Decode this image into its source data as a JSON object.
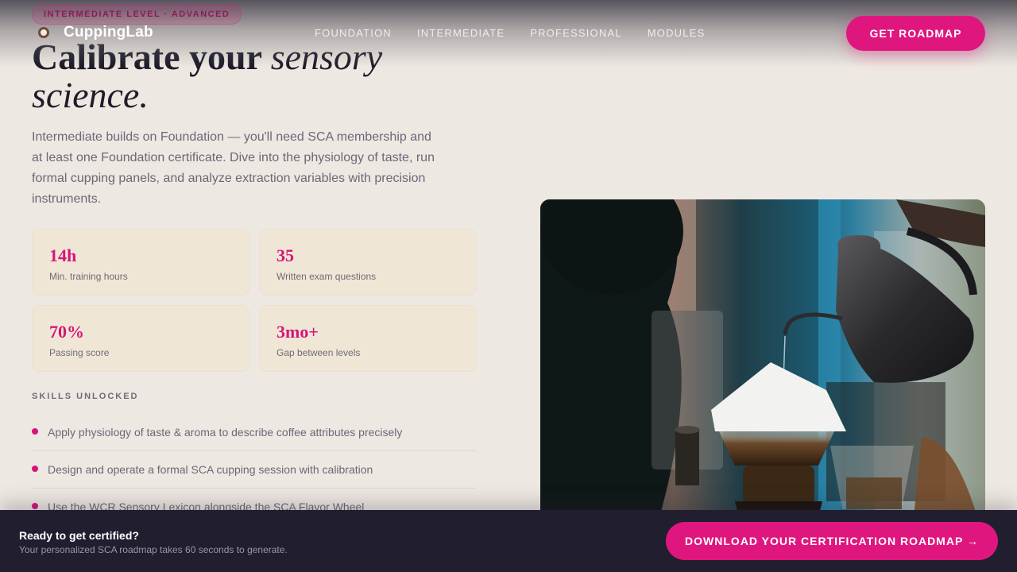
{
  "header": {
    "level_badge": "INTERMEDIATE LEVEL · ADVANCED",
    "brand": "CuppingLab",
    "nav": [
      "FOUNDATION",
      "INTERMEDIATE",
      "PROFESSIONAL",
      "MODULES"
    ],
    "cta": "GET ROADMAP"
  },
  "hero": {
    "headline_strong": "Calibrate your",
    "headline_italic_1": "sensory",
    "headline_italic_2": "science.",
    "intro": "Intermediate builds on Foundation — you'll need SCA membership and at least one Foundation certificate. Dive into the physiology of taste, run formal cupping panels, and analyze extraction variables with precision instruments."
  },
  "stats": [
    {
      "value": "14h",
      "label": "Min. training hours"
    },
    {
      "value": "35",
      "label": "Written exam questions"
    },
    {
      "value": "70%",
      "label": "Passing score"
    },
    {
      "value": "3mo+",
      "label": "Gap between levels"
    }
  ],
  "skills": {
    "title": "SKILLS UNLOCKED",
    "items": [
      "Apply physiology of taste & aroma to describe coffee attributes precisely",
      "Design and operate a formal SCA cupping session with calibration",
      "Use the WCR Sensory Lexicon alongside the SCA Flavor Wheel"
    ]
  },
  "photo": {
    "subject": "pour-over coffee with gooseneck kettle"
  },
  "bottom_bar": {
    "title": "Ready to get certified?",
    "subtitle": "Your personalized SCA roadmap takes 60 seconds to generate.",
    "cta": "DOWNLOAD YOUR CERTIFICATION ROADMAP →"
  },
  "colors": {
    "accent": "#e0167f",
    "background": "#eee8e2",
    "dark_bar": "#211e30",
    "stat_card": "#efe6d6"
  }
}
